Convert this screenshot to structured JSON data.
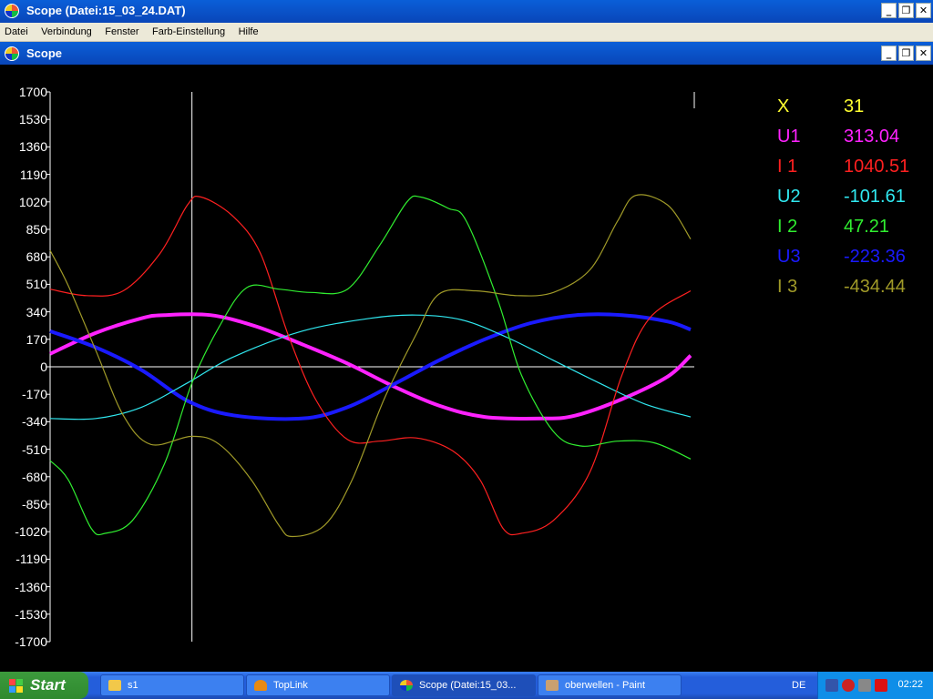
{
  "window": {
    "title": "Scope  (Datei:15_03_24.DAT)"
  },
  "menu": [
    "Datei",
    "Verbindung",
    "Fenster",
    "Farb-Einstellung",
    "Hilfe"
  ],
  "child_window": {
    "title": "Scope"
  },
  "colors": {
    "U1": "#ff22ff",
    "I1": "#ff2020",
    "U2": "#30e8f0",
    "I2": "#30ee30",
    "U3": "#1a1aff",
    "I3": "#a09a28",
    "X": "#ffff30",
    "axis_labels": "#ffffff"
  },
  "chart_data": {
    "type": "line",
    "ylim": [
      -1700,
      1700
    ],
    "yticks": [
      1700,
      1530,
      1360,
      1190,
      1020,
      850,
      680,
      510,
      340,
      170,
      0,
      -170,
      -340,
      -510,
      -680,
      -850,
      -1020,
      -1190,
      -1360,
      -1530,
      -1700
    ],
    "ytick_labels": [
      "1700",
      "1530",
      "1360",
      "1190",
      "1020",
      "850",
      "680",
      "510",
      "340",
      "170",
      "0",
      "-170",
      "-340",
      "-510",
      "-680",
      "-850",
      "-1020",
      "-1190",
      "-1360",
      "-1530",
      "-1700"
    ],
    "x_range": [
      0,
      140
    ],
    "cursor_x": 31,
    "series": [
      {
        "name": "U1",
        "points": [
          [
            0,
            80
          ],
          [
            10,
            210
          ],
          [
            20,
            300
          ],
          [
            25,
            320
          ],
          [
            35,
            320
          ],
          [
            45,
            250
          ],
          [
            55,
            140
          ],
          [
            65,
            20
          ],
          [
            75,
            -120
          ],
          [
            85,
            -240
          ],
          [
            95,
            -310
          ],
          [
            108,
            -320
          ],
          [
            115,
            -300
          ],
          [
            125,
            -200
          ],
          [
            135,
            -60
          ],
          [
            140,
            70
          ]
        ]
      },
      {
        "name": "U3",
        "points": [
          [
            0,
            220
          ],
          [
            10,
            120
          ],
          [
            20,
            -20
          ],
          [
            30,
            -210
          ],
          [
            40,
            -300
          ],
          [
            55,
            -320
          ],
          [
            65,
            -250
          ],
          [
            75,
            -110
          ],
          [
            85,
            40
          ],
          [
            95,
            170
          ],
          [
            105,
            270
          ],
          [
            115,
            320
          ],
          [
            125,
            320
          ],
          [
            135,
            280
          ],
          [
            140,
            230
          ]
        ]
      },
      {
        "name": "U2",
        "points": [
          [
            0,
            -320
          ],
          [
            10,
            -320
          ],
          [
            20,
            -250
          ],
          [
            30,
            -100
          ],
          [
            40,
            60
          ],
          [
            55,
            220
          ],
          [
            70,
            300
          ],
          [
            80,
            320
          ],
          [
            90,
            290
          ],
          [
            100,
            180
          ],
          [
            110,
            40
          ],
          [
            120,
            -100
          ],
          [
            130,
            -230
          ],
          [
            140,
            -310
          ]
        ]
      },
      {
        "name": "I 1",
        "points": [
          [
            0,
            480
          ],
          [
            8,
            440
          ],
          [
            16,
            470
          ],
          [
            24,
            700
          ],
          [
            30,
            1000
          ],
          [
            33,
            1050
          ],
          [
            40,
            930
          ],
          [
            46,
            700
          ],
          [
            52,
            200
          ],
          [
            58,
            -200
          ],
          [
            65,
            -450
          ],
          [
            72,
            -460
          ],
          [
            80,
            -440
          ],
          [
            88,
            -520
          ],
          [
            94,
            -700
          ],
          [
            99,
            -1000
          ],
          [
            103,
            -1030
          ],
          [
            110,
            -950
          ],
          [
            118,
            -650
          ],
          [
            125,
            -50
          ],
          [
            131,
            300
          ],
          [
            140,
            470
          ]
        ]
      },
      {
        "name": "I 2",
        "points": [
          [
            0,
            -580
          ],
          [
            4,
            -700
          ],
          [
            9,
            -1000
          ],
          [
            12,
            -1030
          ],
          [
            18,
            -950
          ],
          [
            25,
            -600
          ],
          [
            31,
            -100
          ],
          [
            37,
            250
          ],
          [
            43,
            490
          ],
          [
            50,
            480
          ],
          [
            57,
            460
          ],
          [
            65,
            480
          ],
          [
            72,
            750
          ],
          [
            78,
            1020
          ],
          [
            81,
            1050
          ],
          [
            87,
            980
          ],
          [
            91,
            900
          ],
          [
            98,
            400
          ],
          [
            103,
            -50
          ],
          [
            110,
            -400
          ],
          [
            116,
            -490
          ],
          [
            124,
            -460
          ],
          [
            132,
            -470
          ],
          [
            140,
            -570
          ]
        ]
      },
      {
        "name": "I 3",
        "points": [
          [
            0,
            720
          ],
          [
            4,
            500
          ],
          [
            10,
            100
          ],
          [
            16,
            -300
          ],
          [
            22,
            -480
          ],
          [
            31,
            -430
          ],
          [
            37,
            -480
          ],
          [
            44,
            -700
          ],
          [
            50,
            -980
          ],
          [
            53,
            -1050
          ],
          [
            60,
            -980
          ],
          [
            66,
            -700
          ],
          [
            73,
            -200
          ],
          [
            80,
            200
          ],
          [
            85,
            450
          ],
          [
            93,
            470
          ],
          [
            102,
            440
          ],
          [
            110,
            460
          ],
          [
            118,
            600
          ],
          [
            124,
            900
          ],
          [
            128,
            1060
          ],
          [
            135,
            1000
          ],
          [
            140,
            790
          ]
        ]
      }
    ]
  },
  "readout": [
    {
      "name": "X",
      "value": "31"
    },
    {
      "name": "U1",
      "value": "313.04"
    },
    {
      "name": "I 1",
      "value": "1040.51"
    },
    {
      "name": "U2",
      "value": "-101.61"
    },
    {
      "name": "I 2",
      "value": "47.21"
    },
    {
      "name": "U3",
      "value": "-223.36"
    },
    {
      "name": "I 3",
      "value": "-434.44"
    }
  ],
  "taskbar": {
    "start": "Start",
    "buttons": [
      "s1",
      "TopLink",
      "Scope  (Datei:15_03...",
      "oberwellen - Paint"
    ],
    "lang": "DE",
    "clock": "02:22"
  }
}
